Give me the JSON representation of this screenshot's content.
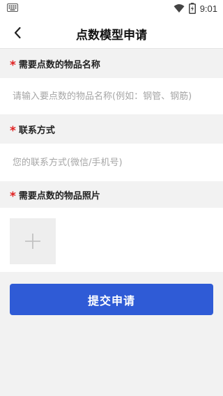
{
  "status_bar": {
    "time": "9:01",
    "icons": [
      "keyboard-icon",
      "wifi-icon",
      "battery-icon"
    ]
  },
  "header": {
    "title": "点数模型申请",
    "back_icon": "chevron-left-icon"
  },
  "form": {
    "item_name": {
      "label": "需要点数的物品名称",
      "required_mark": "*",
      "placeholder": "请输入要点数的物品名称(例如：钢管、钢筋)",
      "value": ""
    },
    "contact": {
      "label": "联系方式",
      "required_mark": "*",
      "placeholder": "您的联系方式(微信/手机号)",
      "value": ""
    },
    "photo": {
      "label": "需要点数的物品照片",
      "required_mark": "*",
      "add_icon": "plus-icon"
    }
  },
  "submit_label": "提交申请",
  "colors": {
    "accent": "#2f5bd6",
    "required": "#e02020",
    "background": "#f2f2f2"
  }
}
